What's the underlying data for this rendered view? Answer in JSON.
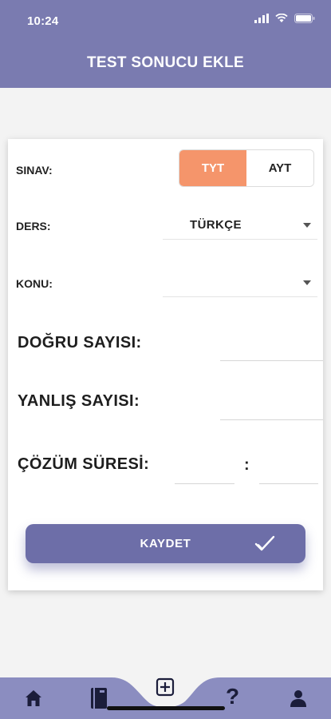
{
  "status": {
    "time": "10:24"
  },
  "header": {
    "title": "TEST SONUCU EKLE"
  },
  "form": {
    "sinav_label": "SINAV:",
    "sinav_options": [
      "TYT",
      "AYT"
    ],
    "sinav_selected": "TYT",
    "ders_label": "DERS:",
    "ders_value": "TÜRKÇE",
    "konu_label": "KONU:",
    "konu_value": "",
    "dogru_label": "DOĞRU SAYISI:",
    "yanlis_label": "YANLIŞ SAYISI:",
    "cozum_label": "ÇÖZÜM SÜRESİ:",
    "cozum_separator": ":",
    "save_label": "KAYDET"
  },
  "nav": {
    "items": [
      "home-icon",
      "book-icon",
      "add-icon",
      "help-icon",
      "profile-icon"
    ],
    "help_glyph": "?"
  },
  "colors": {
    "header": "#7a7bb0",
    "accent": "#f5956b",
    "button": "#6d6ea8",
    "nav": "#8b8dc0"
  }
}
